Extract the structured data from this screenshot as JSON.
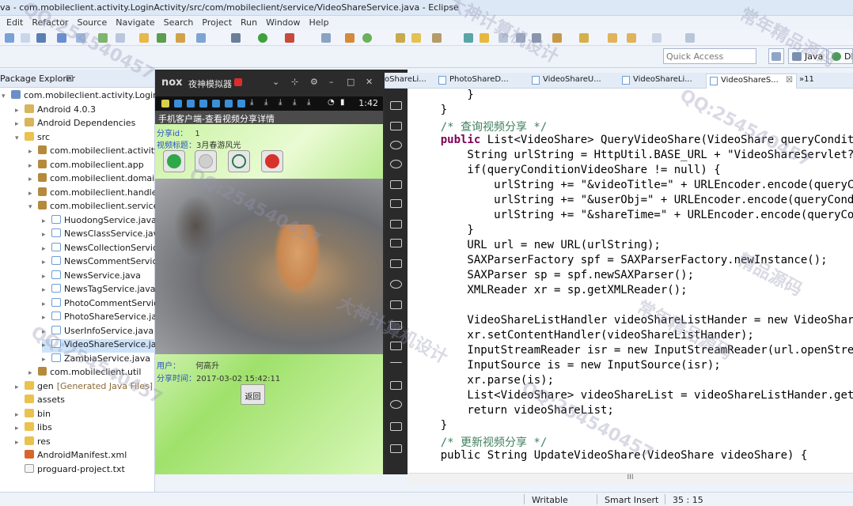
{
  "window": {
    "title": "va - com.mobileclient.activity.LoginActivity/src/com/mobileclient/service/VideoShareService.java - Eclipse"
  },
  "menu": [
    "Edit",
    "Refactor",
    "Source",
    "Navigate",
    "Search",
    "Project",
    "Run",
    "Window",
    "Help"
  ],
  "toolbar": {
    "quick_access_placeholder": "Quick Access",
    "perspective_java": "Java",
    "perspective_ddms": "DD"
  },
  "package_explorer": {
    "title": "Package Explorer",
    "close": "☒",
    "items": [
      {
        "label": "com.mobileclient.activity.LoginActivity",
        "icon": "project-icon",
        "arrow": "▾",
        "level": 0
      },
      {
        "label": "Android 4.0.3",
        "icon": "library-icon",
        "arrow": "▸",
        "level": 1
      },
      {
        "label": "Android Dependencies",
        "icon": "library-icon",
        "arrow": "▸",
        "level": 1
      },
      {
        "label": "src",
        "icon": "folder-icon",
        "arrow": "▾",
        "level": 1
      },
      {
        "label": "com.mobileclient.activity",
        "icon": "package-icon",
        "arrow": "▸",
        "level": 2
      },
      {
        "label": "com.mobileclient.app",
        "icon": "package-icon",
        "arrow": "▸",
        "level": 2
      },
      {
        "label": "com.mobileclient.domain",
        "icon": "package-icon",
        "arrow": "▸",
        "level": 2
      },
      {
        "label": "com.mobileclient.handler",
        "icon": "package-icon",
        "arrow": "▸",
        "level": 2
      },
      {
        "label": "com.mobileclient.service",
        "icon": "package-icon",
        "arrow": "▾",
        "level": 2
      },
      {
        "label": "HuodongService.java",
        "icon": "java-file-icon",
        "arrow": "▸",
        "level": 3
      },
      {
        "label": "NewsClassService.java",
        "icon": "java-file-icon",
        "arrow": "▸",
        "level": 3
      },
      {
        "label": "NewsCollectionService.java",
        "icon": "java-file-icon",
        "arrow": "▸",
        "level": 3
      },
      {
        "label": "NewsCommentService.java",
        "icon": "java-file-icon",
        "arrow": "▸",
        "level": 3
      },
      {
        "label": "NewsService.java",
        "icon": "java-file-icon",
        "arrow": "▸",
        "level": 3
      },
      {
        "label": "NewsTagService.java",
        "icon": "java-file-icon",
        "arrow": "▸",
        "level": 3
      },
      {
        "label": "PhotoCommentService.java",
        "icon": "java-file-icon",
        "arrow": "▸",
        "level": 3
      },
      {
        "label": "PhotoShareService.java",
        "icon": "java-file-icon",
        "arrow": "▸",
        "level": 3
      },
      {
        "label": "UserInfoService.java",
        "icon": "java-file-icon",
        "arrow": "▸",
        "level": 3
      },
      {
        "label": "VideoShareService.java",
        "icon": "java-file-icon",
        "arrow": "▸",
        "level": 3,
        "selected": true
      },
      {
        "label": "ZambiaService.java",
        "icon": "java-file-icon",
        "arrow": "▸",
        "level": 3
      },
      {
        "label": "com.mobileclient.util",
        "icon": "package-icon",
        "arrow": "▸",
        "level": 2
      },
      {
        "label": "gen",
        "decor": "[Generated Java Files]",
        "icon": "folder-icon",
        "arrow": "▸",
        "level": 1
      },
      {
        "label": "assets",
        "icon": "folder-icon",
        "arrow": "",
        "level": 1
      },
      {
        "label": "bin",
        "icon": "folder-icon",
        "arrow": "▸",
        "level": 1
      },
      {
        "label": "libs",
        "icon": "folder-icon",
        "arrow": "▸",
        "level": 1
      },
      {
        "label": "res",
        "icon": "folder-icon",
        "arrow": "▸",
        "level": 1
      },
      {
        "label": "AndroidManifest.xml",
        "icon": "xml-file-icon",
        "arrow": "",
        "level": 1
      },
      {
        "label": "proguard-project.txt",
        "icon": "text-file-icon",
        "arrow": "",
        "level": 1
      }
    ]
  },
  "emulator": {
    "logo": "nox",
    "title": "夜神模拟器",
    "time": "1:42",
    "app": {
      "title": "手机客户端-查看视频分享详情",
      "share_id_label": "分享id：",
      "share_id": "1",
      "video_title_label": "视频标题：",
      "video_title": "3月春游风光",
      "user_label": "用户：",
      "user": "何高升",
      "share_time_label": "分享时间：",
      "share_time": "2017-03-02 15:42:11",
      "back_button": "返回"
    }
  },
  "editor": {
    "tabs": [
      {
        "label": "oShareLi...",
        "active": false
      },
      {
        "label": "PhotoShareD...",
        "active": false
      },
      {
        "label": "VideoShareU...",
        "active": false
      },
      {
        "label": "VideoShareLi...",
        "active": false
      },
      {
        "label": "VideoShareS...",
        "active": true
      }
    ],
    "overflow": "»11",
    "code_lines": [
      "        }",
      "    }",
      "    /* 查询视频分享 */",
      "    public List<VideoShare> QueryVideoShare(VideoShare queryConditi",
      "        String urlString = HttpUtil.BASE_URL + \"VideoShareServlet?a",
      "        if(queryConditionVideoShare != null) {",
      "            urlString += \"&videoTitle=\" + URLEncoder.encode(queryCo",
      "            urlString += \"&userObj=\" + URLEncoder.encode(queryCondi",
      "            urlString += \"&shareTime=\" + URLEncoder.encode(queryCon",
      "        }",
      "        URL url = new URL(urlString);",
      "        SAXParserFactory spf = SAXParserFactory.newInstance();",
      "        SAXParser sp = spf.newSAXParser();",
      "        XMLReader xr = sp.getXMLReader();",
      "",
      "        VideoShareListHandler videoShareListHander = new VideoShare",
      "        xr.setContentHandler(videoShareListHander);",
      "        InputStreamReader isr = new InputStreamReader(url.openStrea",
      "        InputSource is = new InputSource(isr);",
      "        xr.parse(is);",
      "        List<VideoShare> videoShareList = videoShareListHander.getV",
      "        return videoShareList;",
      "    }",
      "    /* 更新视频分享 */",
      "    public String UpdateVideoShare(VideoShare videoShare) {"
    ],
    "hscroll": "III"
  },
  "status": {
    "writable": "Writable",
    "insert_mode": "Smart Insert",
    "position": "35 : 15"
  },
  "watermarks": [
    "QQ:254540457",
    "大神计算机设计",
    "常年精品源码",
    "QQ:254540457",
    "QQ:254540457",
    "精品源码",
    "QQ:254540457",
    "大神计算机设计",
    "QQ:254540457",
    "常年精品源码"
  ]
}
